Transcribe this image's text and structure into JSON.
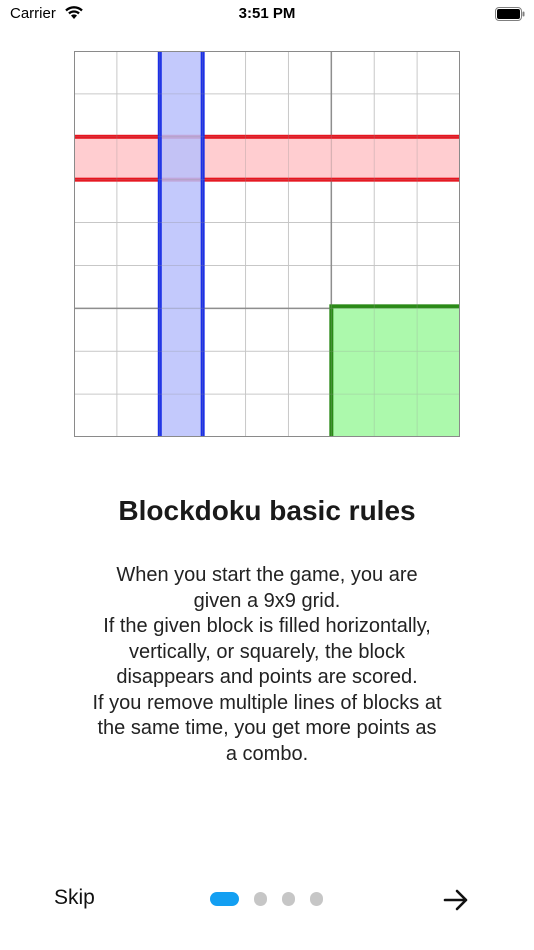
{
  "status_bar": {
    "carrier": "Carrier",
    "time": "3:51 PM"
  },
  "illustration": {
    "grid_size": "9x9",
    "highlights": [
      {
        "kind": "row",
        "index": 2,
        "color": "#e8141e",
        "fill": "#ffc4c8"
      },
      {
        "kind": "column",
        "index": 2,
        "color": "#1a2fe8",
        "fill": "#b9bffb"
      },
      {
        "kind": "square",
        "row": 2,
        "col": 2,
        "color": "#2a8a16",
        "fill": "#a8f9a8"
      }
    ]
  },
  "content": {
    "title": "Blockdoku basic rules",
    "description": "When you start the game, you are\ngiven a 9x9 grid.\nIf the given block is filled horizontally,\nvertically, or squarely, the block\ndisappears and points are scored.\nIf you remove multiple lines of blocks at\nthe same time, you get more points as\na combo."
  },
  "footer": {
    "skip_label": "Skip",
    "page_count": 4,
    "current_page": 1,
    "next_icon": "arrow-right-icon"
  }
}
